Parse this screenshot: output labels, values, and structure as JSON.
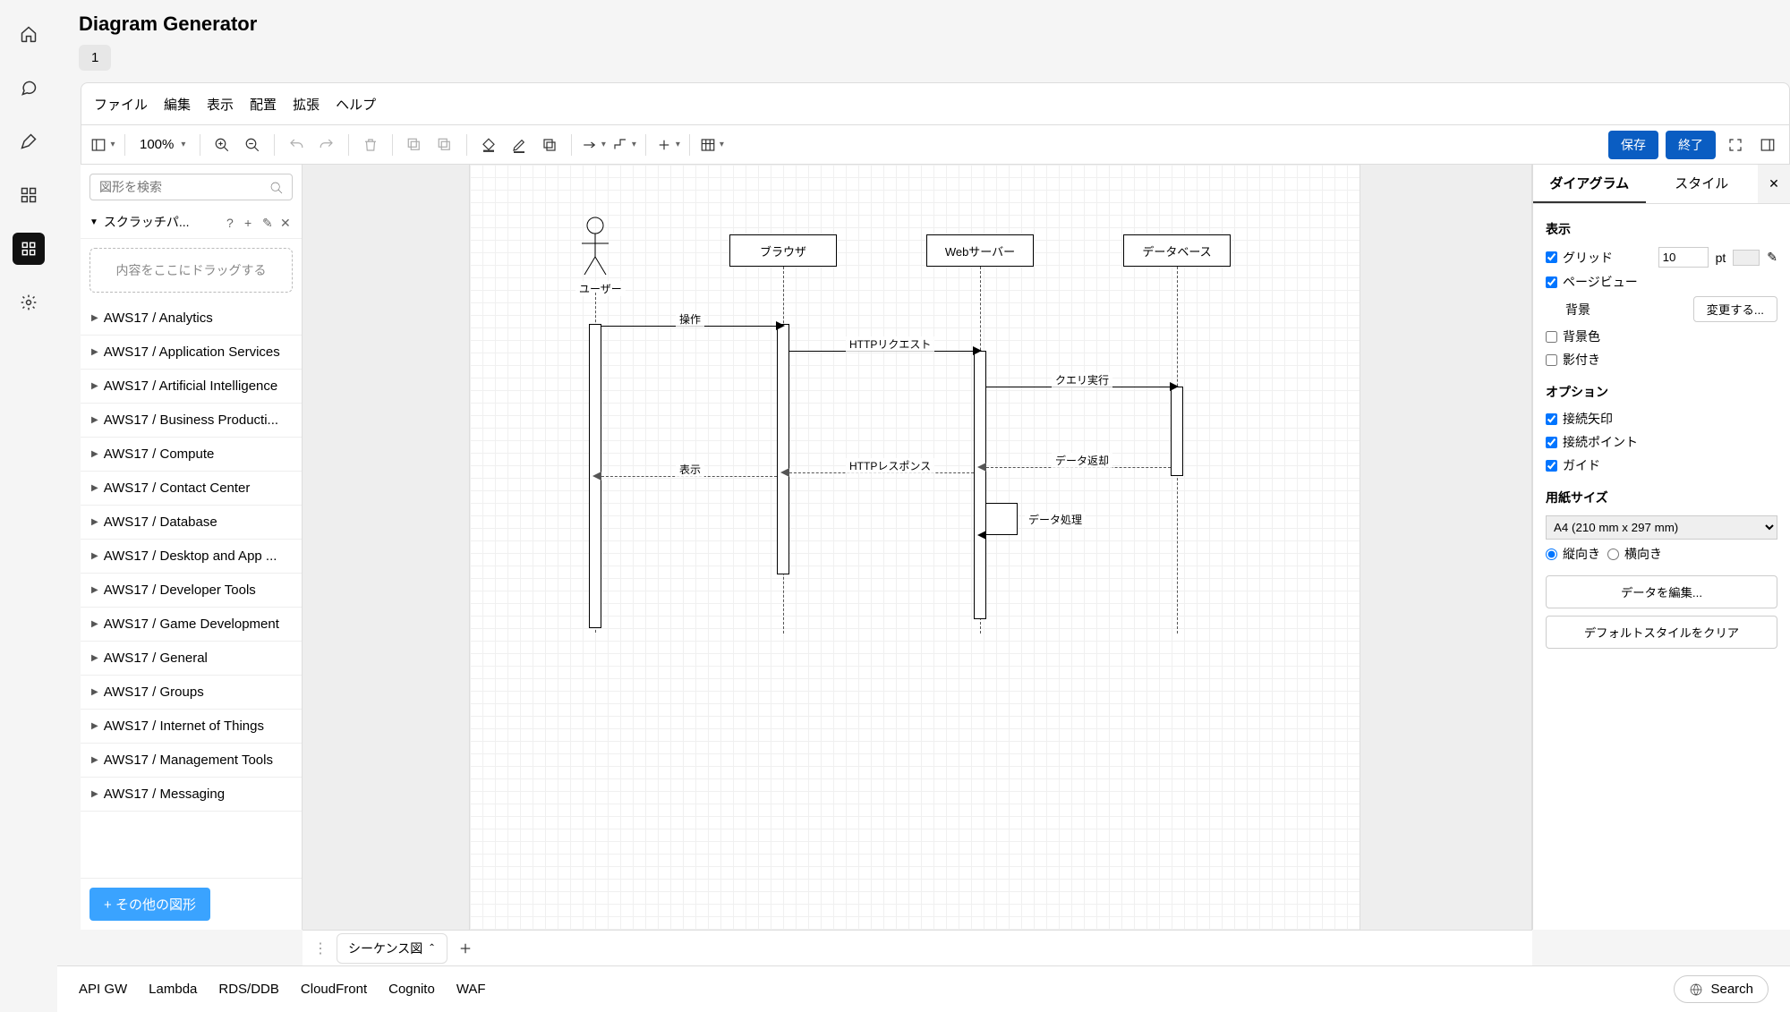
{
  "app_title": "Diagram Generator",
  "top_tab": "1",
  "menubar": [
    "ファイル",
    "編集",
    "表示",
    "配置",
    "拡張",
    "ヘルプ"
  ],
  "toolbar": {
    "zoom": "100%",
    "save": "保存",
    "exit": "終了"
  },
  "palette": {
    "search_placeholder": "図形を検索",
    "scratch_label": "スクラッチパ...",
    "dropzone": "内容をここにドラッグする",
    "more_shapes": "その他の図形",
    "categories": [
      "AWS17 / Analytics",
      "AWS17 / Application Services",
      "AWS17 / Artificial Intelligence",
      "AWS17 / Business Producti...",
      "AWS17 / Compute",
      "AWS17 / Contact Center",
      "AWS17 / Database",
      "AWS17 / Desktop and App ...",
      "AWS17 / Developer Tools",
      "AWS17 / Game Development",
      "AWS17 / General",
      "AWS17 / Groups",
      "AWS17 / Internet of Things",
      "AWS17 / Management Tools",
      "AWS17 / Messaging"
    ]
  },
  "diagram": {
    "participants": {
      "user": "ユーザー",
      "browser": "ブラウザ",
      "webserver": "Webサーバー",
      "database": "データベース"
    },
    "messages": {
      "m1": "操作",
      "m2": "HTTPリクエスト",
      "m3": "クエリ実行",
      "m4": "データ返却",
      "m5": "HTTPレスポンス",
      "m6": "表示",
      "m7": "データ処理"
    }
  },
  "pagetab": "シーケンス図",
  "right_panel": {
    "tab_diagram": "ダイアグラム",
    "tab_style": "スタイル",
    "section_display": "表示",
    "grid": "グリッド",
    "grid_value": "10",
    "grid_unit": "pt",
    "pageview": "ページビュー",
    "background": "背景",
    "change_btn": "変更する...",
    "bgcolor": "背景色",
    "shadow": "影付き",
    "section_options": "オプション",
    "conn_arrow": "接続矢印",
    "conn_point": "接続ポイント",
    "guide": "ガイド",
    "section_papersize": "用紙サイズ",
    "paper_select": "A4 (210 mm x 297 mm)",
    "portrait": "縦向き",
    "landscape": "横向き",
    "edit_data": "データを編集...",
    "clear_style": "デフォルトスタイルをクリア"
  },
  "footer": {
    "chips": [
      "API GW",
      "Lambda",
      "RDS/DDB",
      "CloudFront",
      "Cognito",
      "WAF"
    ],
    "search": "Search"
  }
}
